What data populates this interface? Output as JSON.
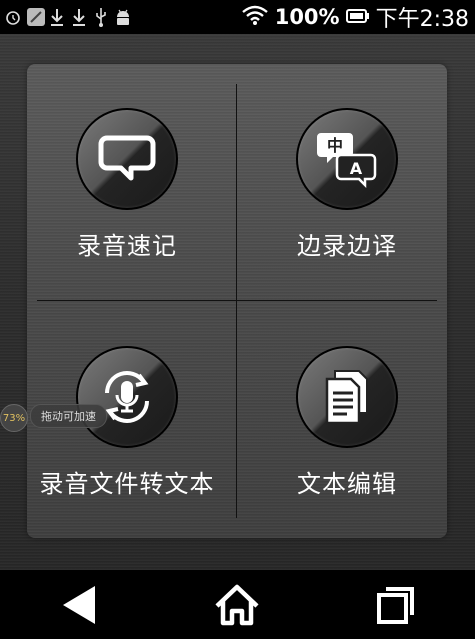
{
  "status_bar": {
    "battery_percent": "100%",
    "time": "下午2:38",
    "icons": [
      "alarm-icon",
      "app-icon",
      "download-icon",
      "download-icon",
      "usb-icon",
      "android-icon",
      "wifi-icon",
      "battery-icon"
    ]
  },
  "menu": {
    "items": [
      {
        "label": "录音速记",
        "icon": "speech-bubble-icon"
      },
      {
        "label": "边录边译",
        "icon": "translate-icon",
        "glyphs": [
          "中",
          "A"
        ]
      },
      {
        "label": "录音文件转文本",
        "icon": "microphone-convert-icon"
      },
      {
        "label": "文本编辑",
        "icon": "documents-icon"
      }
    ]
  },
  "floating_widget": {
    "percent": "73%",
    "hint": "拖动可加速"
  },
  "nav_bar": {
    "icons": [
      "back-icon",
      "home-icon",
      "recent-apps-icon"
    ]
  }
}
